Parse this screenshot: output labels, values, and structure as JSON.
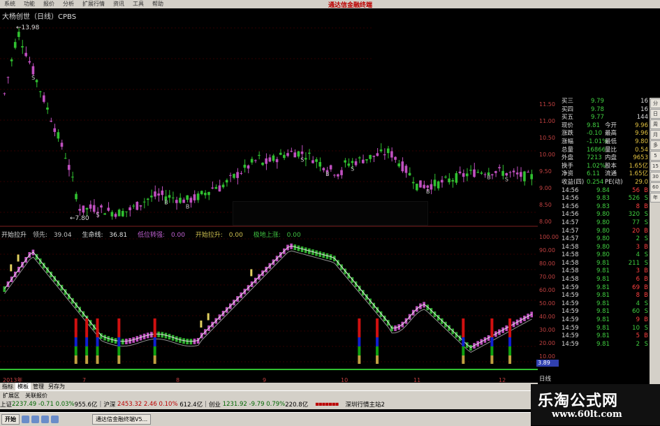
{
  "menu": {
    "items": [
      "系统",
      "功能",
      "报价",
      "分析",
      "扩展行情",
      "资讯",
      "工具",
      "帮助"
    ],
    "brand": "通达信金融终端"
  },
  "chart": {
    "title": "大杨创世（日线）CPBS",
    "high_label": "13.98",
    "low_label": "7.80",
    "price_scale": [
      "11.50",
      "11.00",
      "10.50",
      "10.00",
      "9.50",
      "9.00",
      "8.50",
      "8.00"
    ],
    "date_labels": [
      "2013年",
      "7",
      "8",
      "9",
      "10",
      "11",
      "12"
    ],
    "ind_scale": [
      "100.00",
      "90.00",
      "80.00",
      "70.00",
      "60.00",
      "50.00",
      "40.00",
      "30.00",
      "20.00",
      "10.00"
    ],
    "ind_value_box": "3.89",
    "period": "日线"
  },
  "indicator": {
    "name": "开始拉升",
    "items": [
      {
        "label": "领先:",
        "value": "39.04",
        "color": "#c0c0c0"
      },
      {
        "label": "生命线:",
        "value": "36.81",
        "color": "#d8d8d8"
      },
      {
        "label": "低位转强:",
        "value": "0.00",
        "color": "#c060d0"
      },
      {
        "label": "开始拉升:",
        "value": "0.00",
        "color": "#d0c050"
      },
      {
        "label": "极地上涨:",
        "value": "0.00",
        "color": "#40c040"
      }
    ]
  },
  "tabs": {
    "row1": [
      "指标",
      "模板",
      "管理",
      "另存为"
    ],
    "row2": [
      "扩展区",
      "关联报价"
    ]
  },
  "indexbar": {
    "sh_label": "上证",
    "sh_value": "2237.49",
    "sh_change": "-0.71",
    "sh_pct": "0.03%",
    "sh_amount": "955.6亿",
    "sz_label": "沪深",
    "sz_value": "2453.32",
    "sz_change": "2.46",
    "sz_pct": "0.10%",
    "sz_amount": "612.4亿",
    "cy_label": "创业",
    "cy_value": "1231.92",
    "cy_change": "-9.79",
    "cy_pct": "0.79%",
    "cy_amount": "220.8亿",
    "extra": "深圳行情主站2"
  },
  "taskbar": {
    "start": "开始",
    "item": "通达信金融终端V5..."
  },
  "quote": {
    "bids": [
      {
        "label": "买三",
        "price": "9.79",
        "vol": "16"
      },
      {
        "label": "买四",
        "price": "9.78",
        "vol": "16"
      },
      {
        "label": "买五",
        "price": "9.77",
        "vol": "144"
      }
    ],
    "stats": [
      {
        "l1": "现价",
        "v1": "9.81",
        "l2": "今开",
        "v2": "9.96"
      },
      {
        "l1": "涨跌",
        "v1": "-0.10",
        "l2": "最高",
        "v2": "9.96"
      },
      {
        "l1": "涨幅",
        "v1": "-1.01%",
        "l2": "最低",
        "v2": "9.80"
      },
      {
        "l1": "总量",
        "v1": "16866",
        "l2": "量比",
        "v2": "0.54"
      },
      {
        "l1": "外盘",
        "v1": "7213",
        "l2": "内盘",
        "v2": "9653"
      },
      {
        "l1": "换手",
        "v1": "1.02%",
        "l2": "股本",
        "v2": "1.65亿"
      },
      {
        "l1": "净资",
        "v1": "6.11",
        "l2": "流通",
        "v2": "1.65亿"
      },
      {
        "l1": "收益(四)",
        "v1": "0.254",
        "l2": "PE(动)",
        "v2": "29.0"
      }
    ],
    "ticks": [
      {
        "t": "14:56",
        "p": "9.84",
        "v": "56",
        "d": "B"
      },
      {
        "t": "14:56",
        "p": "9.83",
        "v": "526",
        "d": "S"
      },
      {
        "t": "14:56",
        "p": "9.83",
        "v": "8",
        "d": "B"
      },
      {
        "t": "14:56",
        "p": "9.80",
        "v": "320",
        "d": "S"
      },
      {
        "t": "14:57",
        "p": "9.80",
        "v": "77",
        "d": "S"
      },
      {
        "t": "14:57",
        "p": "9.80",
        "v": "20",
        "d": "B"
      },
      {
        "t": "14:57",
        "p": "9.80",
        "v": "2",
        "d": "S"
      },
      {
        "t": "14:58",
        "p": "9.80",
        "v": "3",
        "d": "B"
      },
      {
        "t": "14:58",
        "p": "9.80",
        "v": "4",
        "d": "S"
      },
      {
        "t": "14:58",
        "p": "9.81",
        "v": "211",
        "d": "S"
      },
      {
        "t": "14:58",
        "p": "9.81",
        "v": "3",
        "d": "B"
      },
      {
        "t": "14:58",
        "p": "9.81",
        "v": "6",
        "d": "B"
      },
      {
        "t": "14:59",
        "p": "9.81",
        "v": "69",
        "d": "B"
      },
      {
        "t": "14:59",
        "p": "9.81",
        "v": "8",
        "d": "B"
      },
      {
        "t": "14:59",
        "p": "9.81",
        "v": "4",
        "d": "S"
      },
      {
        "t": "14:59",
        "p": "9.81",
        "v": "60",
        "d": "S"
      },
      {
        "t": "14:59",
        "p": "9.81",
        "v": "9",
        "d": "B"
      },
      {
        "t": "14:59",
        "p": "9.81",
        "v": "10",
        "d": "S"
      },
      {
        "t": "14:59",
        "p": "9.81",
        "v": "5",
        "d": "B"
      },
      {
        "t": "14:59",
        "p": "9.81",
        "v": "2",
        "d": "S"
      }
    ]
  },
  "sidebar": [
    "分",
    "日",
    "周",
    "月",
    "多",
    "5",
    "15",
    "30",
    "60",
    "年"
  ],
  "brand": {
    "line1": "乐淘公式网",
    "line2": "www.60lt.com"
  },
  "colors": {
    "up": "#ff4040",
    "down": "#20d0d0",
    "bg": "#000000"
  }
}
